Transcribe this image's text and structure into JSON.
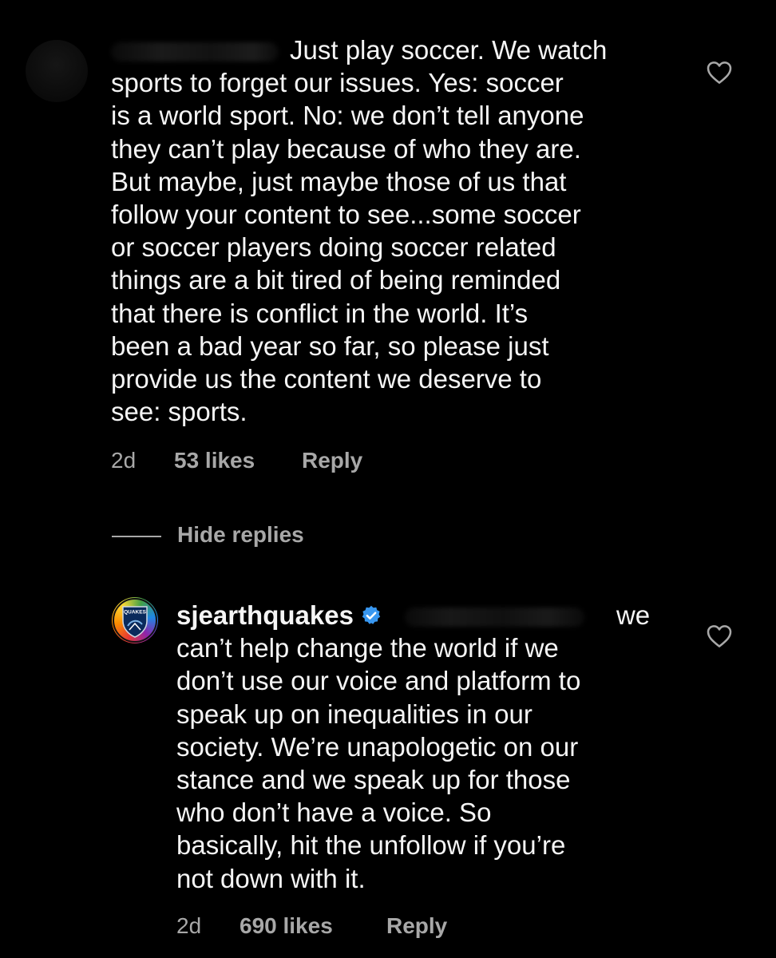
{
  "comment_1": {
    "lines": [
      "Just play soccer. We watch",
      "sports to forget our issues. Yes: soccer",
      "is a world sport. No: we don’t tell anyone",
      "they can’t play because of who they are.",
      "But maybe, just maybe those of us that",
      "follow your content to see...some soccer",
      "or soccer players doing soccer related",
      "things are a bit tired of being reminded",
      "that there is conflict in the world. It’s",
      "been a bad year so far, so please just",
      "provide us the content we deserve to",
      "see: sports."
    ],
    "time": "2d",
    "likes": "53 likes",
    "reply": "Reply"
  },
  "hide_replies": {
    "label": "Hide replies"
  },
  "comment_2": {
    "username": "sjearthquakes",
    "avatar_badge": "QUAKES",
    "first_line_end": "we",
    "lines": [
      "can’t help change the world if we",
      "don’t use our voice and platform to",
      "speak up on inequalities in our",
      "society. We’re unapologetic on our",
      "stance and we speak up for those",
      "who don’t have a voice. So",
      "basically, hit the unfollow if you’re",
      "not down with it."
    ],
    "time": "2d",
    "likes": "690 likes",
    "reply": "Reply"
  },
  "colors": {
    "background": "#000000",
    "text": "#f5f5f5",
    "secondary": "#a8a8a8",
    "verified": "#3897f0"
  },
  "icons": [
    "heart-icon",
    "verified-badge-icon",
    "avatar"
  ]
}
